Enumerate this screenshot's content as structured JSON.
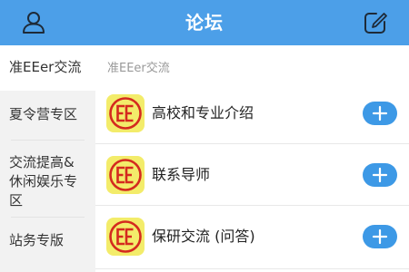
{
  "header": {
    "title": "论坛",
    "profile_icon": "user-profile-icon",
    "compose_icon": "compose-edit-icon",
    "background_color": "#4c9fe8"
  },
  "sidebar": {
    "items": [
      {
        "label": "准EEer交流",
        "active": true
      },
      {
        "label": "夏令营专区",
        "active": false
      },
      {
        "label": "交流提高&休闲娱乐专区",
        "active": false
      },
      {
        "label": "站务专版",
        "active": false
      }
    ]
  },
  "main": {
    "section_title": "准EEer交流",
    "forums": [
      {
        "name": "高校和专业介绍",
        "logo": "ee-logo-icon",
        "action_icon": "plus-icon"
      },
      {
        "name": "联系导师",
        "logo": "ee-logo-icon",
        "action_icon": "plus-icon"
      },
      {
        "name": "保研交流 (问答)",
        "logo": "ee-logo-icon",
        "action_icon": "plus-icon"
      }
    ]
  },
  "colors": {
    "accent": "#3d99e6",
    "logo_yellow": "#f3ec6a",
    "logo_red": "#d42a1f",
    "sidebar_bg": "#f2f2f2"
  }
}
